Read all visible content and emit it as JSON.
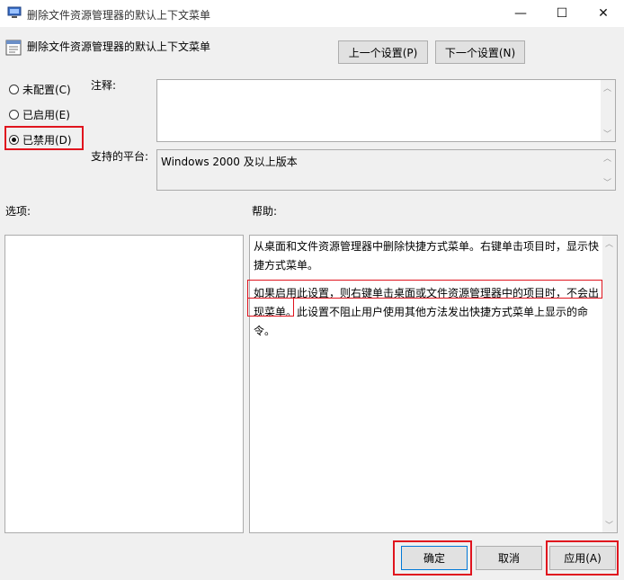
{
  "window": {
    "title": "删除文件资源管理器的默认上下文菜单",
    "minimize_glyph": "—",
    "maximize_glyph": "☐",
    "close_glyph": "✕"
  },
  "header": {
    "policy_name": "删除文件资源管理器的默认上下文菜单",
    "prev_button": "上一个设置(P)",
    "next_button": "下一个设置(N)"
  },
  "state": {
    "options": [
      {
        "label": "未配置(C)",
        "selected": false
      },
      {
        "label": "已启用(E)",
        "selected": false
      },
      {
        "label": "已禁用(D)",
        "selected": true
      }
    ]
  },
  "comment": {
    "label": "注释:",
    "value": ""
  },
  "platform": {
    "label": "支持的平台:",
    "value": "Windows 2000 及以上版本"
  },
  "options_section": {
    "label": "选项:"
  },
  "help_section": {
    "label": "帮助:",
    "para1": "从桌面和文件资源管理器中删除快捷方式菜单。右键单击项目时，显示快捷方式菜单。",
    "para2": "如果启用此设置，则右键单击桌面或文件资源管理器中的项目时，不会出现菜单。此设置不阻止用户使用其他方法发出快捷方式菜单上显示的命令。"
  },
  "footer": {
    "ok": "确定",
    "cancel": "取消",
    "apply": "应用(A)"
  },
  "colors": {
    "highlight_red": "#e0141e",
    "window_bg": "#f0f0f0"
  }
}
